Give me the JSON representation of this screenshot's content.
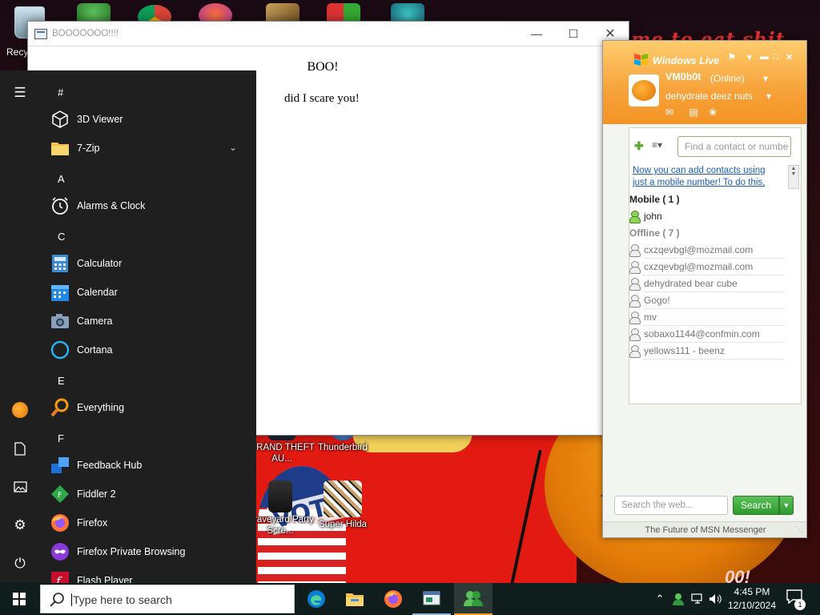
{
  "desktop": {
    "recycle_label": "Recy",
    "wallpaper_text": "me to eat shit",
    "wallpaper_sign": "VOTE",
    "wallpaper_flash": "00!",
    "shortcuts": [
      {
        "label": "GRAND THEFT AU...",
        "icon": "gta-icon"
      },
      {
        "label": "Thunderbird",
        "icon": "thunderbird-icon"
      },
      {
        "label": "Graveyard Party Scre...",
        "icon": "graveyard-icon"
      },
      {
        "label": "Super Hilda",
        "icon": "super-hilda-icon"
      }
    ]
  },
  "boo_window": {
    "title": "BOOOOOOO!!!!",
    "heading": "BOO!",
    "text": "did I scare you!"
  },
  "start_menu": {
    "rail": [
      "menu-icon",
      "user-avatar",
      "documents-icon",
      "pictures-icon",
      "settings-icon",
      "power-icon"
    ],
    "sections": [
      {
        "letter": "#",
        "apps": [
          {
            "label": "3D Viewer",
            "icon": "3d-viewer-icon"
          },
          {
            "label": "7-Zip",
            "icon": "folder-icon",
            "expandable": true
          }
        ]
      },
      {
        "letter": "A",
        "apps": [
          {
            "label": "Alarms & Clock",
            "icon": "alarm-clock-icon"
          }
        ]
      },
      {
        "letter": "C",
        "apps": [
          {
            "label": "Calculator",
            "icon": "calculator-icon"
          },
          {
            "label": "Calendar",
            "icon": "calendar-icon"
          },
          {
            "label": "Camera",
            "icon": "camera-icon"
          },
          {
            "label": "Cortana",
            "icon": "cortana-icon"
          }
        ]
      },
      {
        "letter": "E",
        "apps": [
          {
            "label": "Everything",
            "icon": "everything-search-icon"
          }
        ]
      },
      {
        "letter": "F",
        "apps": [
          {
            "label": "Feedback Hub",
            "icon": "feedback-hub-icon"
          },
          {
            "label": "Fiddler 2",
            "icon": "fiddler-icon"
          },
          {
            "label": "Firefox",
            "icon": "firefox-icon"
          },
          {
            "label": "Firefox Private Browsing",
            "icon": "firefox-private-icon"
          },
          {
            "label": "Flash Player",
            "icon": "flash-player-icon"
          }
        ]
      }
    ]
  },
  "messenger": {
    "brand": "Windows Live",
    "username": "VM0b0t",
    "status": "(Online)",
    "personal_message": "dehydrate deez nuts",
    "find_placeholder": "Find a contact or numbe",
    "notice": "Now you can add contacts using just a mobile number! To do this,",
    "groups": [
      {
        "title": "Mobile ( 1 )",
        "online": true,
        "contacts": [
          "john"
        ]
      },
      {
        "title": "Offline ( 7 )",
        "online": false,
        "contacts": [
          "cxzqevbgl@mozmail.com",
          "cxzqevbgl@mozmail.com",
          "dehydrated bear cube",
          "Gogo!",
          "mv",
          "sobaxo1144@confmin.com",
          "yellows111  - beenz"
        ]
      }
    ],
    "search_placeholder": "Search the web...",
    "search_button": "Search",
    "footer": "The Future of MSN Messenger"
  },
  "taskbar": {
    "search_placeholder": "Type here to search",
    "apps": [
      "edge-icon",
      "file-explorer-icon",
      "firefox-icon",
      "app-window-icon",
      "messenger-icon"
    ],
    "active_app": "messenger-icon",
    "time": "4:45 PM",
    "date": "12/10/2024",
    "notification_count": "1"
  },
  "colors": {
    "start_bg": "#1f1f1f",
    "taskbar_bg": "#0f1e1c",
    "msn_orange": "#f7a23a",
    "msn_green": "#2c9a2c",
    "link_blue": "#1a5fb4"
  }
}
